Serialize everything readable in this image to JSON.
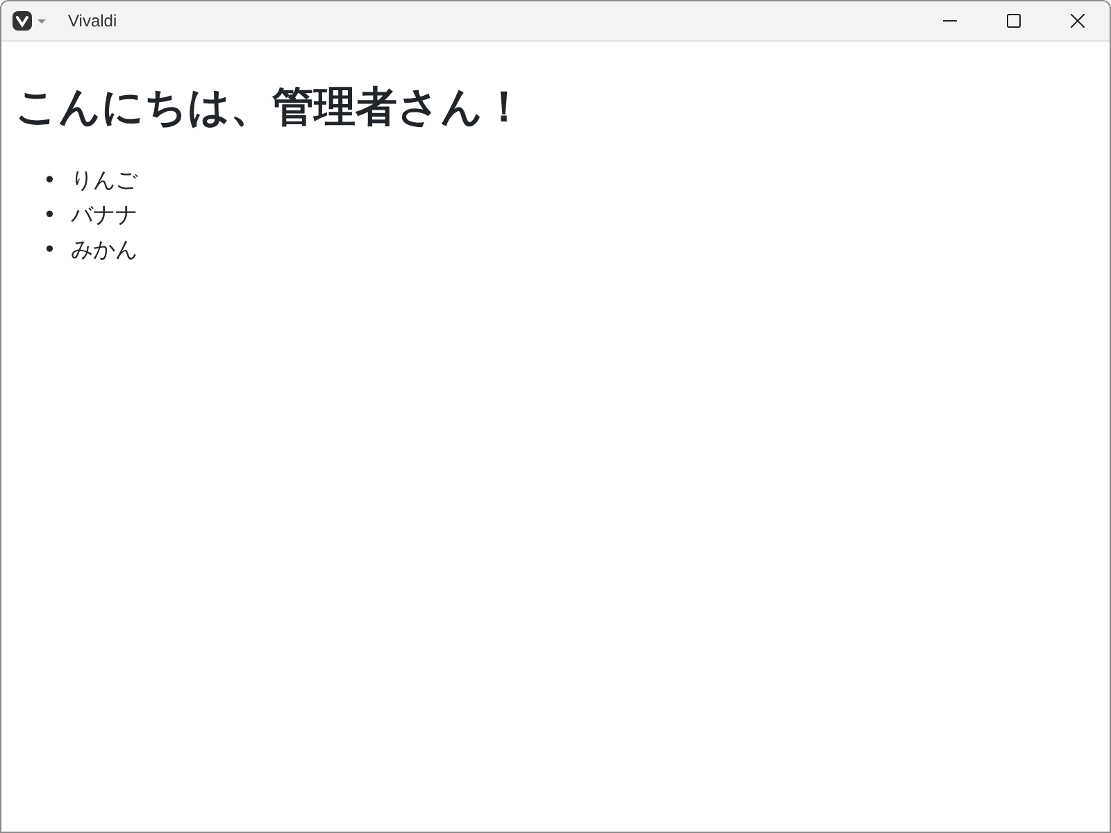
{
  "window": {
    "title": "Vivaldi"
  },
  "heading": "こんにちは、管理者さん！",
  "items": [
    {
      "marker": "•",
      "text": "りんご"
    },
    {
      "marker": "•",
      "text": "バナナ"
    },
    {
      "marker": "•",
      "text": "みかん"
    }
  ]
}
